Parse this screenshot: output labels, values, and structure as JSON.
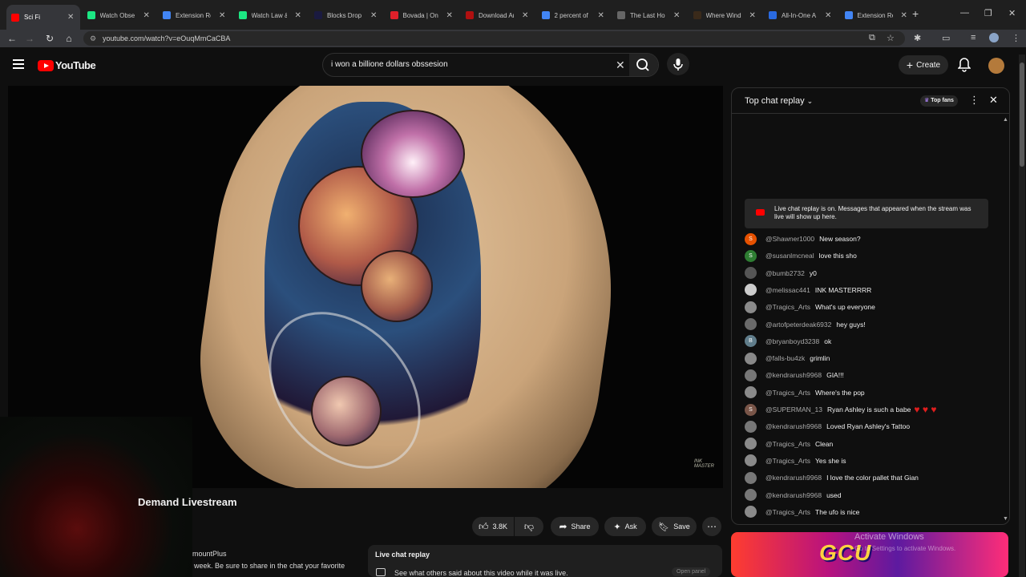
{
  "browser": {
    "tabs": [
      {
        "title": "Sci Fi",
        "color": "#ff0000",
        "active": true
      },
      {
        "title": "Watch Obse",
        "color": "#1ce783"
      },
      {
        "title": "Extension Re",
        "color": "#4285f4"
      },
      {
        "title": "Watch Law &",
        "color": "#1ce783"
      },
      {
        "title": "Blocks Drop",
        "color": "#1a1a40"
      },
      {
        "title": "Bovada | Onl",
        "color": "#e0202a"
      },
      {
        "title": "Download Ar",
        "color": "#b01010"
      },
      {
        "title": "2 percent of",
        "color": "#4285f4"
      },
      {
        "title": "The Last Hou",
        "color": "#666666"
      },
      {
        "title": "Where Wind",
        "color": "#3a2a1a"
      },
      {
        "title": "All-In-One A",
        "color": "#2a6ae0"
      },
      {
        "title": "Extension Re",
        "color": "#4285f4"
      }
    ],
    "new_tab": "+",
    "url": "youtube.com/watch?v=eOuqMmCaCBA"
  },
  "youtube": {
    "logo_text": "YouTube",
    "search_query": "i won a billione dollars obssesion",
    "create_label": "Create"
  },
  "video": {
    "title_fragment": "Demand Livestream",
    "watermark": "INK MASTER",
    "actions": {
      "likes": "3.8K",
      "share": "Share",
      "ask": "Ask",
      "save": "Save"
    },
    "description_a": "mountPlus",
    "description_b": "week. Be sure to share in the chat your favorite"
  },
  "replay_card": {
    "heading": "Live chat replay",
    "text": "See what others said about this video while it was live.",
    "button": "Open panel"
  },
  "chat": {
    "title": "Top chat replay",
    "top_fans": "Top fans",
    "notice": "Live chat replay is on. Messages that appeared when the stream was live will show up here.",
    "messages": [
      {
        "author": "@Shawner1000",
        "text": "New season?",
        "initial": "S",
        "color": "#e65100"
      },
      {
        "author": "@susanlmcneal",
        "text": "love this sho",
        "initial": "S",
        "color": "#2e7d32"
      },
      {
        "author": "@bumb2732",
        "text": "y0",
        "initial": "",
        "color": "#555555"
      },
      {
        "author": "@melissac441",
        "text": "INK MASTERRRR",
        "initial": "",
        "color": "#cccccc"
      },
      {
        "author": "@Tragics_Arts",
        "text": "What's up everyone",
        "initial": "",
        "color": "#8a8a8a"
      },
      {
        "author": "@artofpeterdeak6932",
        "text": "hey guys!",
        "initial": "",
        "color": "#6a6a6a"
      },
      {
        "author": "@bryanboyd3238",
        "text": "ok",
        "initial": "B",
        "color": "#607d8b"
      },
      {
        "author": "@falls-bu4zk",
        "text": "grimlin",
        "initial": "",
        "color": "#888888"
      },
      {
        "author": "@kendrarush9968",
        "text": "GIA!!!",
        "initial": "",
        "color": "#777777"
      },
      {
        "author": "@Tragics_Arts",
        "text": "Where's the pop",
        "initial": "",
        "color": "#8a8a8a"
      },
      {
        "author": "@SUPERMAN_13",
        "text": "Ryan Ashley is such a babe",
        "initial": "S",
        "color": "#795548",
        "hearts": "♥ ♥ ♥"
      },
      {
        "author": "@kendrarush9968",
        "text": "Loved Ryan Ashley's Tattoo",
        "initial": "",
        "color": "#777777"
      },
      {
        "author": "@Tragics_Arts",
        "text": "Clean",
        "initial": "",
        "color": "#8a8a8a"
      },
      {
        "author": "@Tragics_Arts",
        "text": "Yes she is",
        "initial": "",
        "color": "#8a8a8a"
      },
      {
        "author": "@kendrarush9968",
        "text": "I love the color pallet that Gian",
        "initial": "",
        "color": "#777777"
      },
      {
        "author": "@kendrarush9968",
        "text": "used",
        "initial": "",
        "color": "#777777"
      },
      {
        "author": "@Tragics_Arts",
        "text": "The ufo is nice",
        "initial": "",
        "color": "#8a8a8a"
      }
    ]
  },
  "ad": {
    "logo": "GCU"
  },
  "os_watermark": {
    "line1": "Activate Windows",
    "line2": "Go to Settings to activate Windows."
  }
}
